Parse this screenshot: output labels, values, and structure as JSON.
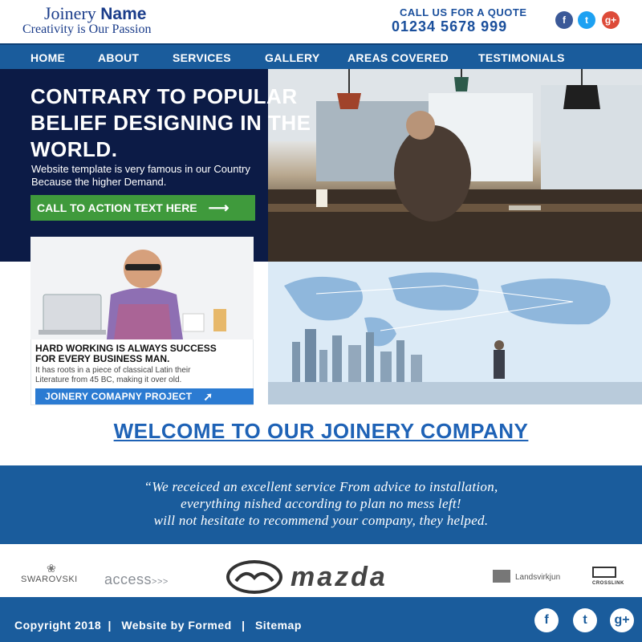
{
  "header": {
    "logo_word": "Joinery",
    "logo_bold": "Name",
    "tagline": "Creativity is Our Passion",
    "quote_label": "CALL US FOR A QUOTE",
    "phone": "01234 5678 999",
    "social": [
      {
        "icon": "facebook-icon",
        "glyph": "f",
        "color": "#3b5998"
      },
      {
        "icon": "twitter-icon",
        "glyph": "t",
        "color": "#1da1f2"
      },
      {
        "icon": "google-plus-icon",
        "glyph": "g+",
        "color": "#dd4b39"
      }
    ]
  },
  "nav": {
    "items": [
      "HOME",
      "ABOUT",
      "SERVICES",
      "GALLERY",
      "AREAS COVERED",
      "TESTIMONIALS"
    ]
  },
  "hero": {
    "title": "CONTRARY TO POPULAR BELIEF DESIGNING IN THE WORLD.",
    "subtitle_line1": "Website template is very famous in our Country",
    "subtitle_line2": "Because the higher Demand.",
    "cta_label": "CALL TO ACTION TEXT HERE",
    "cta_color": "#3f9a3c"
  },
  "card": {
    "heading_line1": "HARD WORKING IS ALWAYS SUCCESS",
    "heading_line2": "FOR EVERY BUSINESS MAN.",
    "text_line1": "It has roots in a piece of classical Latin their",
    "text_line2": "Literature from 45 BC, making it over old.",
    "button_label": "JOINERY COMAPNY PROJECT"
  },
  "welcome": {
    "title": "WELCOME TO OUR JOINERY COMPANY"
  },
  "testimonial": {
    "line1": "“We receiced an excellent service From advice to installation,",
    "line2": "everything nished according to plan no mess left!",
    "line3": "will not hesitate to recommend your company, they helped."
  },
  "partners": {
    "swarovski": "SWAROVSKI",
    "access": "access",
    "access_suffix": ">>>",
    "mazda": "mazda",
    "landsvirkjun": "Landsvirkjun",
    "crosslink": "CROSSLINK"
  },
  "footer": {
    "copyright": "Copyright 2018",
    "credit": "Website by Formed",
    "sitemap": "Sitemap",
    "separator": "|",
    "social": [
      {
        "icon": "facebook-icon",
        "glyph": "f"
      },
      {
        "icon": "twitter-icon",
        "glyph": "t"
      },
      {
        "icon": "google-plus-icon",
        "glyph": "g+"
      }
    ]
  },
  "colors": {
    "brand_blue": "#1a5c9c",
    "dark_navy": "#0c1b46",
    "link_blue": "#1e62b6"
  }
}
